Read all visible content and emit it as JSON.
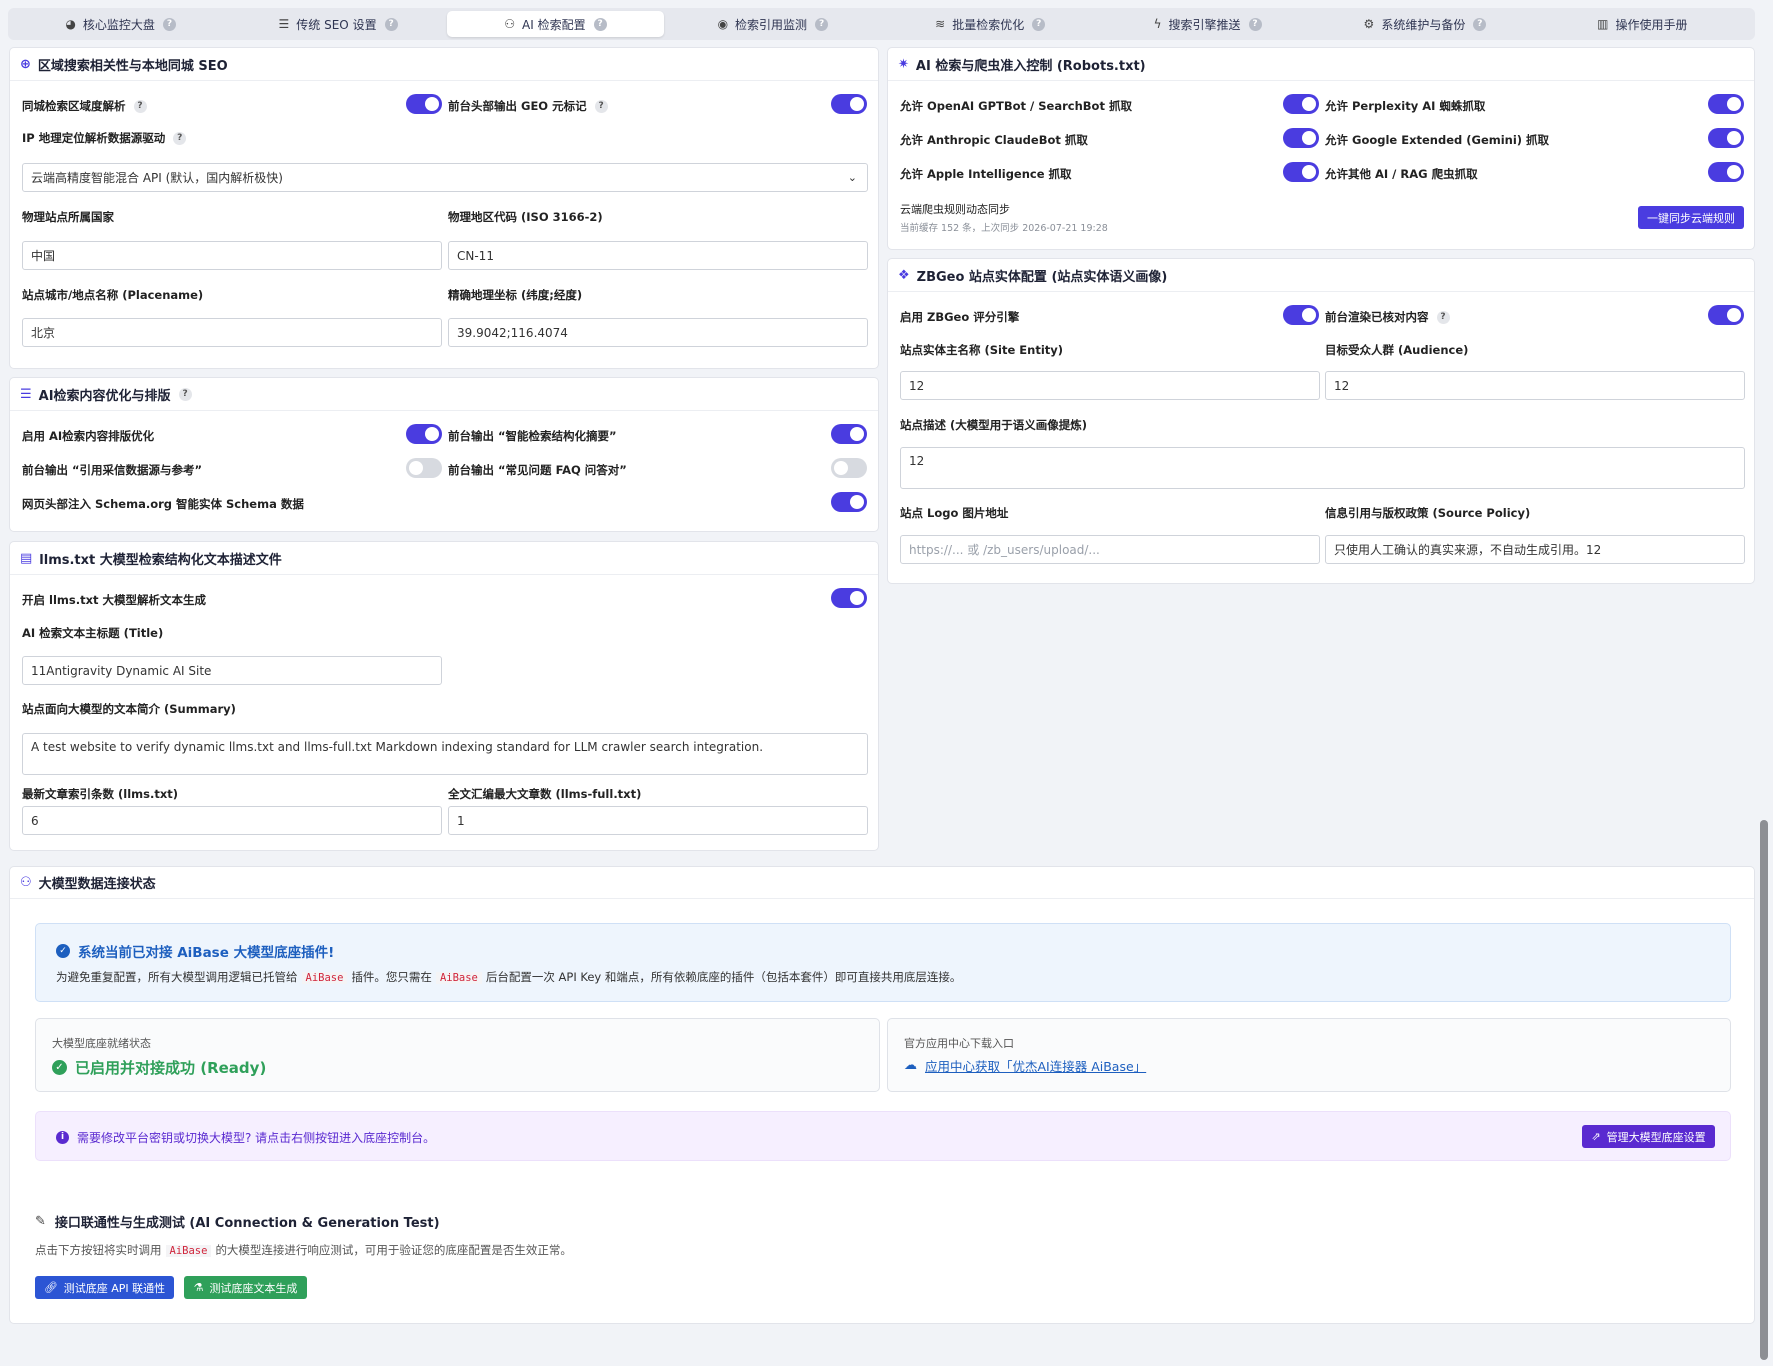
{
  "tabs": [
    {
      "label": "核心监控大盘",
      "icon": "chart-pie-icon"
    },
    {
      "label": "传统 SEO 设置",
      "icon": "sliders-icon"
    },
    {
      "label": "AI 检索配置",
      "icon": "sitemap-icon"
    },
    {
      "label": "检索引用监测",
      "icon": "eye-icon"
    },
    {
      "label": "批量检索优化",
      "icon": "layers-icon"
    },
    {
      "label": "搜索引擎推送",
      "icon": "bolt-icon"
    },
    {
      "label": "系统维护与备份",
      "icon": "gears-icon"
    },
    {
      "label": "操作使用手册",
      "icon": "book-icon"
    }
  ],
  "active_tab": 2,
  "geo": {
    "title": "区域搜索相关性与本地同城 SEO",
    "enable_label": "同城检索区域度解析",
    "enable_on": true,
    "geo_meta_label": "前台头部输出 GEO 元标记",
    "geo_meta_on": true,
    "ip_driver_label": "IP 地理定位解析数据源驱动",
    "ip_driver_value": "云端高精度智能混合 API (默认，国内解析极快)",
    "country_label": "物理站点所属国家",
    "country_value": "中国",
    "region_label": "物理地区代码 (ISO 3166-2)",
    "region_value": "CN-11",
    "placename_label": "站点城市/地点名称 (Placename)",
    "placename_value": "北京",
    "coords_label": "精确地理坐标 (纬度;经度)",
    "coords_value": "39.9042;116.4074"
  },
  "ai_opt": {
    "title": "AI检索内容优化与排版",
    "r1_label": "启用 AI检索内容排版优化",
    "r1_on": true,
    "r1b_label": "前台输出 “智能检索结构化摘要”",
    "r1b_on": true,
    "r2_label": "前台输出 “引用采信数据源与参考”",
    "r2_on": false,
    "r2b_label": "前台输出 “常见问题 FAQ 问答对”",
    "r2b_on": false,
    "r3_label": "网页头部注入 Schema.org 智能实体 Schema 数据",
    "r3_on": true
  },
  "llms": {
    "title": "llms.txt 大模型检索结构化文本描述文件",
    "enable_label": "开启 llms.txt 大模型解析文本生成",
    "enable_on": true,
    "title_label": "AI 检索文本主标题 (Title)",
    "title_value": "11Antigravity Dynamic AI Site",
    "summary_label": "站点面向大模型的文本简介 (Summary)",
    "summary_value": "A test website to verify dynamic llms.txt and llms-full.txt Markdown indexing standard for LLM crawler search integration.",
    "count_label": "最新文章索引条数 (llms.txt)",
    "count_value": "6",
    "full_label": "全文汇编最大文章数 (llms-full.txt)",
    "full_value": "1"
  },
  "robots": {
    "title": "AI 检索与爬虫准入控制 (Robots.txt)",
    "items": [
      {
        "label": "允许 OpenAI GPTBot / SearchBot 抓取",
        "on": true
      },
      {
        "label": "允许 Perplexity AI 蜘蛛抓取",
        "on": true
      },
      {
        "label": "允许 Anthropic ClaudeBot 抓取",
        "on": true
      },
      {
        "label": "允许 Google Extended (Gemini) 抓取",
        "on": true
      },
      {
        "label": "允许 Apple Intelligence 抓取",
        "on": true
      },
      {
        "label": "允许其他 AI / RAG 爬虫抓取",
        "on": true
      }
    ],
    "sync_title": "云端爬虫规则动态同步",
    "sync_info": "当前缓存 152 条，上次同步 2026-07-21 19:28",
    "sync_button": "一键同步云端规则"
  },
  "zbgeo": {
    "title": "ZBGeo 站点实体配置 (站点实体语义画像)",
    "engine_label": "启用 ZBGeo 评分引擎",
    "engine_on": true,
    "render_label": "前台渲染已核对内容",
    "render_on": true,
    "entity_label": "站点实体主名称 (Site Entity)",
    "entity_value": "12",
    "audience_label": "目标受众人群 (Audience)",
    "audience_value": "12",
    "desc_label": "站点描述 (大模型用于语义画像提炼)",
    "desc_value": "12",
    "logo_label": "站点 Logo 图片地址",
    "logo_placeholder": "https://... 或 /zb_users/upload/...",
    "policy_label": "信息引用与版权政策 (Source Policy)",
    "policy_value": "只使用人工确认的真实来源，不自动生成引用。12"
  },
  "status": {
    "title": "大模型数据连接状态",
    "notice_title": "系统当前已对接 AiBase 大模型底座插件!",
    "notice_p1": "为避免重复配置，所有大模型调用逻辑已托管给",
    "notice_code1": "AiBase",
    "notice_p2": "插件。您只需在",
    "notice_code2": "AiBase",
    "notice_p3": "后台配置一次 API Key 和端点，所有依赖底座的插件（包括本套件）即可直接共用底层连接。",
    "ready_caption": "大模型底座就绪状态",
    "ready_value": "已启用并对接成功 (Ready)",
    "download_caption": "官方应用中心下载入口",
    "download_link": "应用中心获取「优杰AI连接器 AiBase」",
    "hint": "需要修改平台密钥或切换大模型? 请点击右侧按钮进入底座控制台。",
    "manage_button": "管理大模型底座设置",
    "test_title": "接口联通性与生成测试 (AI Connection & Generation Test)",
    "test_p1": "点击下方按钮将实时调用",
    "test_code": "AiBase",
    "test_p2": "的大模型连接进行响应测试，可用于验证您的底座配置是否生效正常。",
    "btn_api": "测试底座 API 联通性",
    "btn_gen": "测试底座文本生成"
  },
  "colors": {
    "accent": "#4a3ce0",
    "success": "#2fa05a",
    "info_blue": "#1d5fbf",
    "purple": "#5a2ad0"
  }
}
